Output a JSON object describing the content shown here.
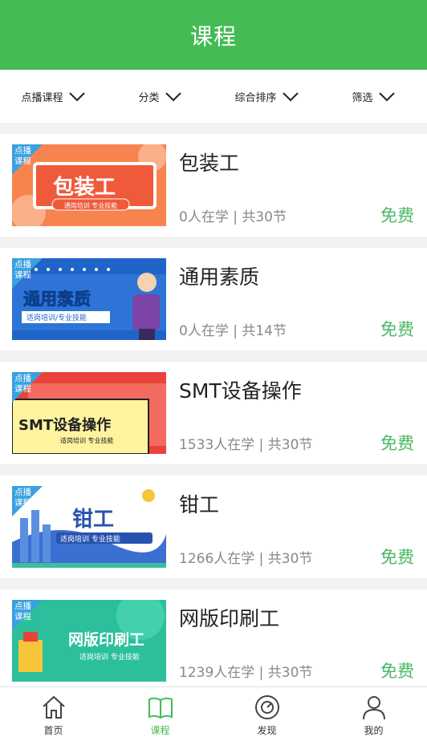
{
  "header": {
    "title": "课程"
  },
  "filters": [
    {
      "label": "点播课程"
    },
    {
      "label": "分类"
    },
    {
      "label": "综合排序"
    },
    {
      "label": "筛选"
    }
  ],
  "thumb_tag": "点播\n课程",
  "courses": [
    {
      "title": "包装工",
      "meta": "0人在学 | 共30节",
      "price": "免费",
      "banner_title": "包装工",
      "banner_sub": "通岗培训 专业技能"
    },
    {
      "title": "通用素质",
      "meta": "0人在学 | 共14节",
      "price": "免费",
      "banner_title": "通用素质",
      "banner_sub": "适岗培训/专业技能"
    },
    {
      "title": "SMT设备操作",
      "meta": "1533人在学 | 共30节",
      "price": "免费",
      "banner_title": "SMT设备操作",
      "banner_sub": "适岗培训 专业技能"
    },
    {
      "title": "钳工",
      "meta": "1266人在学 | 共30节",
      "price": "免费",
      "banner_title": "钳工",
      "banner_sub": "适岗培训 专业技能"
    },
    {
      "title": "网版印刷工",
      "meta": "1239人在学 | 共30节",
      "price": "免费",
      "banner_title": "网版印刷工",
      "banner_sub": "适岗培训 专业技能"
    }
  ],
  "tabbar": [
    {
      "label": "首页",
      "icon": "home-icon"
    },
    {
      "label": "课程",
      "icon": "book-icon",
      "active": true
    },
    {
      "label": "发现",
      "icon": "compass-icon"
    },
    {
      "label": "我的",
      "icon": "user-icon"
    }
  ],
  "colors": {
    "primary": "#44bb55",
    "price": "#4ab863"
  }
}
